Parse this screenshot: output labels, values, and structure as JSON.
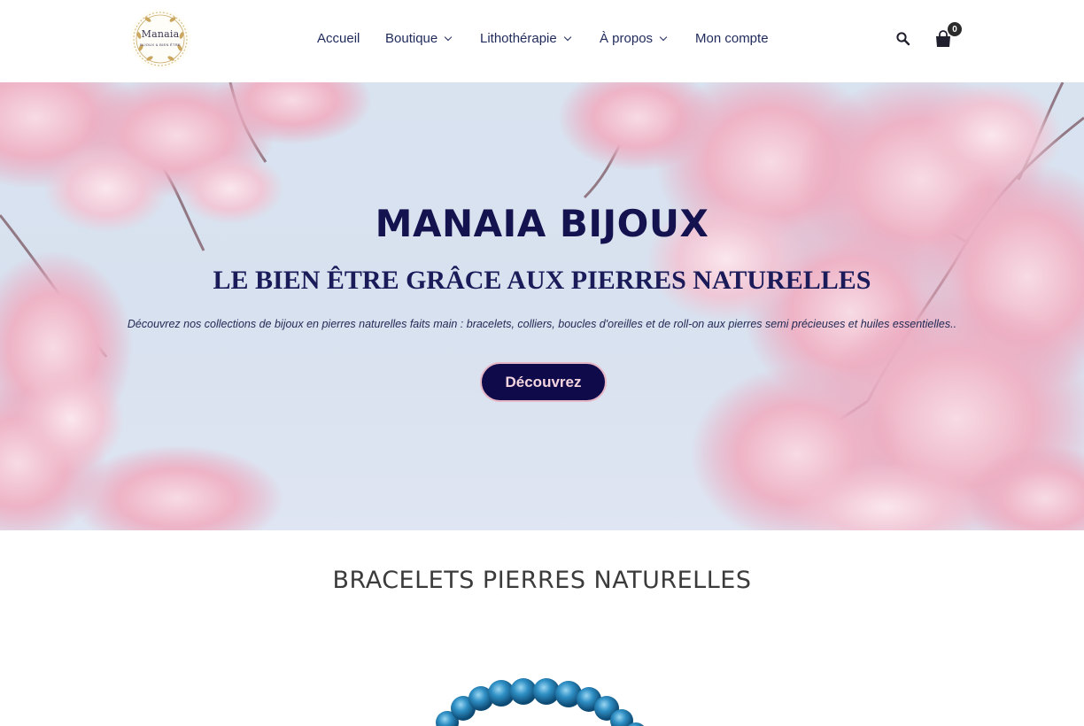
{
  "site": {
    "logo_name": "Manaia",
    "logo_tagline": "BIJOUX & BIEN ÊTRE"
  },
  "nav": {
    "items": [
      {
        "label": "Accueil",
        "has_dropdown": false
      },
      {
        "label": "Boutique",
        "has_dropdown": true
      },
      {
        "label": "Lithothérapie",
        "has_dropdown": true
      },
      {
        "label": "À propos",
        "has_dropdown": true
      },
      {
        "label": "Mon compte",
        "has_dropdown": false
      }
    ]
  },
  "header_icons": {
    "search": "search-icon",
    "cart": "shopping-bag-icon",
    "cart_count": "0"
  },
  "hero": {
    "title": "MANAIA BIJOUX",
    "subtitle": "LE BIEN ÊTRE GRÂCE AUX PIERRES NATURELLES",
    "description": "Découvrez nos collections de bijoux en pierres naturelles faits main : bracelets, colliers, boucles d'oreilles et de roll-on aux pierres semi précieuses et huiles essentielles..",
    "button_label": "Découvrez"
  },
  "section": {
    "title": "BRACELETS PIERRES NATURELLES"
  },
  "colors": {
    "brand_navy": "#14124f",
    "button_bg": "#0f0b4a",
    "button_border": "#e6b7c7",
    "blossom_pink": "#efb6c9",
    "sky": "#d9e3f0"
  }
}
